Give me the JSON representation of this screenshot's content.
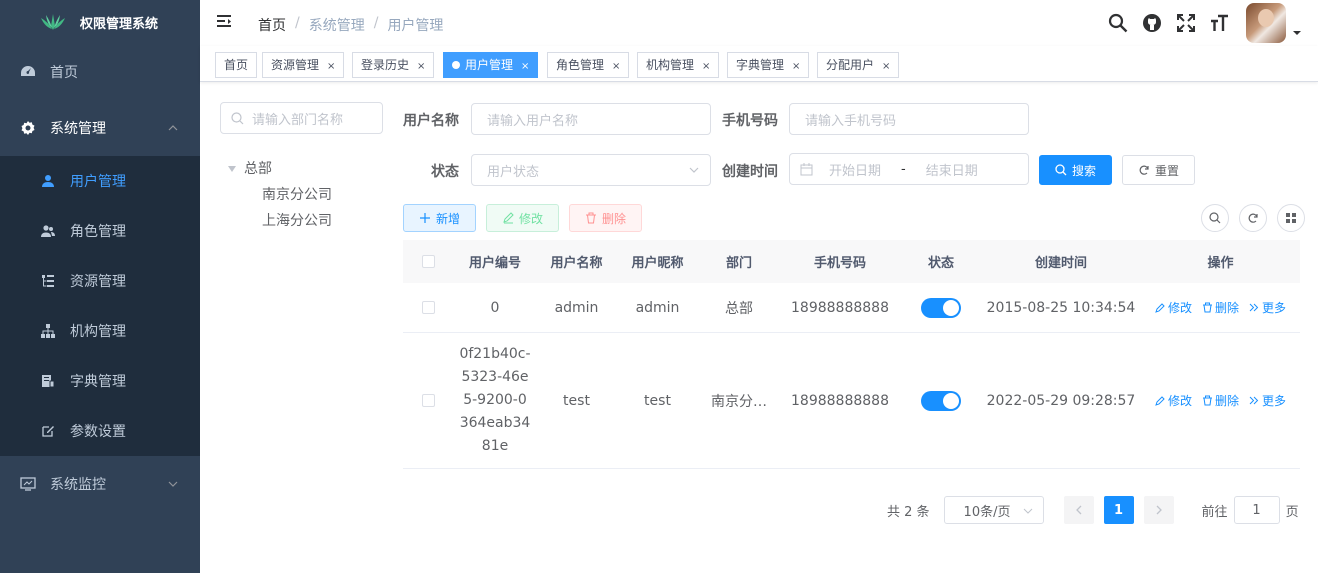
{
  "app": {
    "title": "权限管理系统"
  },
  "sidebar": {
    "home": "首页",
    "system": "系统管理",
    "items": [
      {
        "label": "用户管理",
        "icon": "user-icon"
      },
      {
        "label": "角色管理",
        "icon": "peoples-icon"
      },
      {
        "label": "资源管理",
        "icon": "tree-table-icon"
      },
      {
        "label": "机构管理",
        "icon": "tree-icon"
      },
      {
        "label": "字典管理",
        "icon": "dict-icon"
      },
      {
        "label": "参数设置",
        "icon": "edit-icon"
      }
    ],
    "monitor": "系统监控"
  },
  "breadcrumb": [
    "首页",
    "系统管理",
    "用户管理"
  ],
  "tags": [
    {
      "label": "首页",
      "closable": false
    },
    {
      "label": "资源管理",
      "closable": true
    },
    {
      "label": "登录历史",
      "closable": true
    },
    {
      "label": "用户管理",
      "closable": true,
      "active": true
    },
    {
      "label": "角色管理",
      "closable": true
    },
    {
      "label": "机构管理",
      "closable": true
    },
    {
      "label": "字典管理",
      "closable": true
    },
    {
      "label": "分配用户",
      "closable": true
    }
  ],
  "tag_close": "×",
  "dept": {
    "search_placeholder": "请输入部门名称",
    "root": "总部",
    "children": [
      "南京分公司",
      "上海分公司"
    ]
  },
  "form": {
    "username_label": "用户名称",
    "username_placeholder": "请输入用户名称",
    "phone_label": "手机号码",
    "phone_placeholder": "请输入手机号码",
    "status_label": "状态",
    "status_placeholder": "用户状态",
    "created_label": "创建时间",
    "start_placeholder": "开始日期",
    "range_sep": "-",
    "end_placeholder": "结束日期",
    "search_btn": "搜索",
    "reset_btn": "重置"
  },
  "toolbar": {
    "add": "新增",
    "edit": "修改",
    "delete": "删除"
  },
  "table": {
    "headers": [
      "用户编号",
      "用户名称",
      "用户昵称",
      "部门",
      "手机号码",
      "状态",
      "创建时间",
      "操作"
    ],
    "rows": [
      {
        "id": "0",
        "name": "admin",
        "nick": "admin",
        "dept": "总部",
        "phone": "18988888888",
        "enabled": true,
        "created": "2015-08-25 10:34:54"
      },
      {
        "id": "0f21b40c-5323-46e5-9200-0364eab3481e",
        "name": "test",
        "nick": "test",
        "dept": "南京分…",
        "phone": "18988888888",
        "enabled": true,
        "created": "2022-05-29 09:28:57"
      }
    ],
    "id_lines": [
      "0f21b40c-",
      "5323-46e",
      "5-9200-0",
      "364eab34",
      "81e"
    ],
    "ops": {
      "edit": "修改",
      "delete": "删除",
      "more": "更多"
    }
  },
  "pagination": {
    "total_text": "共 2 条",
    "page_size": "10条/页",
    "current": "1",
    "goto": "前往",
    "goto_value": "1",
    "page_unit": "页"
  },
  "colors": {
    "sidebar": "#304156",
    "submenu": "#1f2d3d",
    "primary": "#1890ff",
    "active_menu": "#409eff"
  }
}
